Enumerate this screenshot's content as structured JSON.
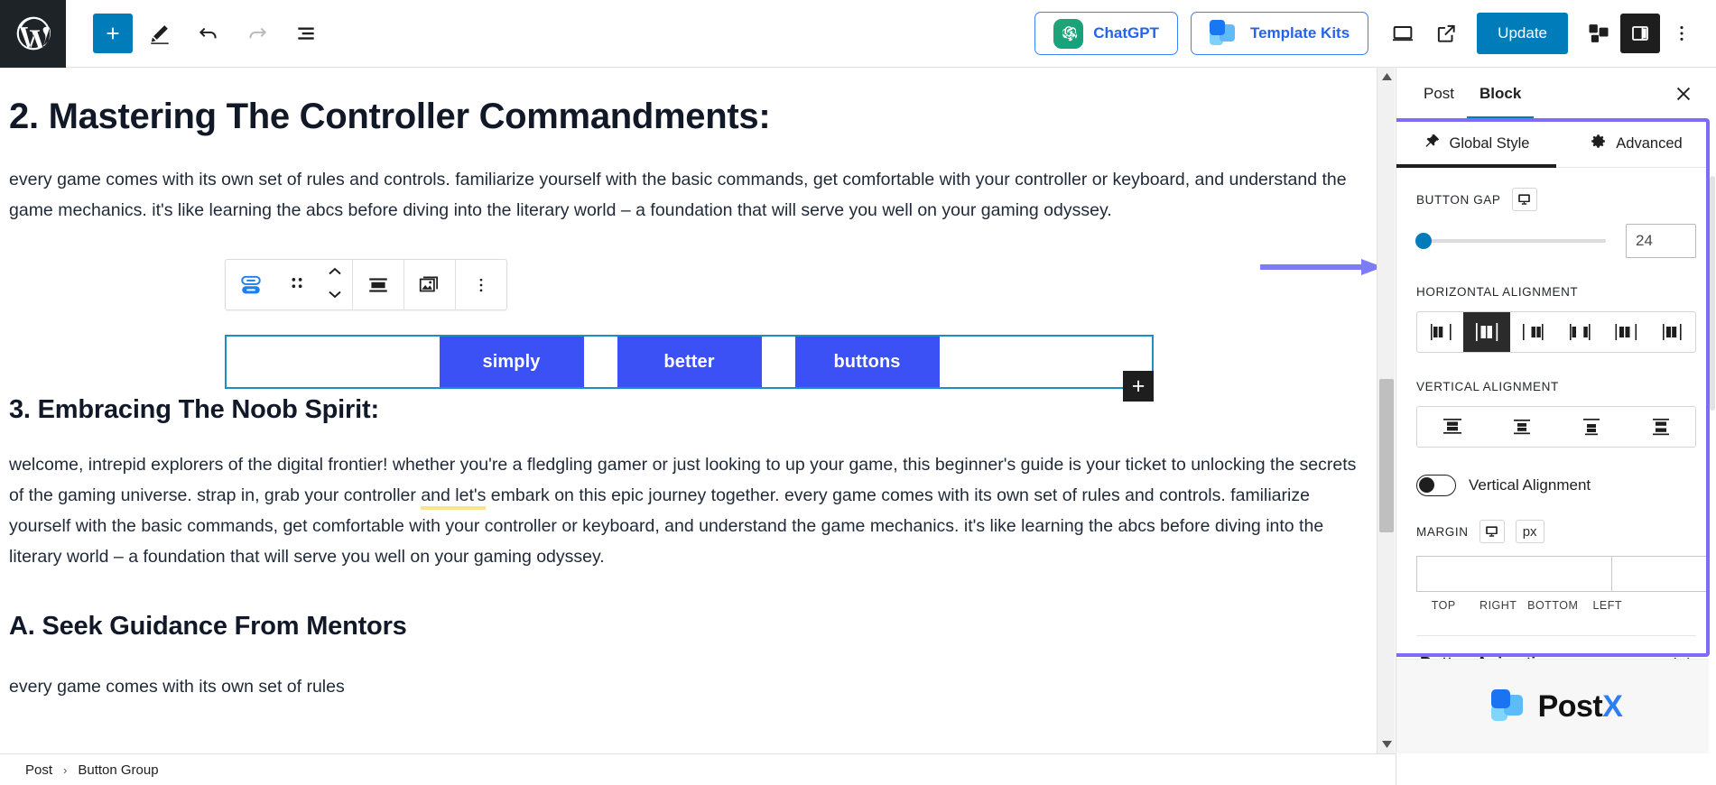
{
  "toolbar": {
    "wordpress_logo": "wordpress-logo",
    "add_block_label": "+",
    "tools_icon": "pencil-icon",
    "undo_icon": "undo-icon",
    "redo_icon": "redo-icon",
    "list_view_icon": "document-outline-icon",
    "chatgpt_label": "ChatGPT",
    "template_kits_label": "Template Kits",
    "preview_icon": "desktop-preview-icon",
    "view_icon": "external-link-icon",
    "update_label": "Update",
    "blocks_icon": "blocks-grid-icon",
    "settings_icon": "sidebar-panel-icon",
    "options_icon": "kebab-menu-icon"
  },
  "content": {
    "heading_1": "2. Mastering The Controller Commandments:",
    "paragraph_1": "every game comes with its own set of rules and controls. familiarize yourself with the basic commands, get comfortable with your controller or keyboard, and understand the game mechanics. it's like learning the abcs before diving into the literary world – a foundation that will serve you well on your gaming odyssey.",
    "heading_2": "3. Embracing The Noob Spirit:",
    "paragraph_2_a": "welcome, intrepid explorers of the digital frontier! whether you're a fledgling gamer or just looking to up your game, this beginner's guide is your ticket to unlocking the secrets of the gaming universe. strap in, grab your controller ",
    "paragraph_2_highlight": "and let's",
    "paragraph_2_b": " embark on this epic journey together. every game comes with its own set of rules and controls. familiarize yourself with the basic commands, get comfortable with your controller or keyboard, and understand the game mechanics. it's like learning the abcs before diving into the literary world – a foundation that will serve you well on your gaming odyssey.",
    "heading_3": "A. Seek Guidance From Mentors",
    "paragraph_3": "every game comes with its own set of rules"
  },
  "block_toolbar": {
    "block_type_icon": "buttons-block-icon",
    "drag_icon": "drag-handle-icon",
    "move_up_icon": "chevron-up-icon",
    "move_down_icon": "chevron-down-icon",
    "align_icon": "align-center-icon",
    "gallery_icon": "image-stack-icon",
    "more_icon": "kebab-menu-icon"
  },
  "button_group": {
    "buttons": [
      "simply",
      "better",
      "buttons"
    ],
    "appender_label": "+",
    "selected_color": "#1a8fc4",
    "button_color": "#3b50f5"
  },
  "sidebar": {
    "tabs": [
      {
        "label": "Post",
        "active": false
      },
      {
        "label": "Block",
        "active": true
      }
    ],
    "close_icon": "close-icon",
    "panel_tabs": [
      {
        "label": "Global Style",
        "icon": "pin-icon",
        "active": true
      },
      {
        "label": "Advanced",
        "icon": "gear-icon",
        "active": false
      }
    ],
    "button_gap": {
      "label": "BUTTON GAP",
      "responsive_icon": "desktop-icon",
      "value": "24",
      "slider_percent": 4
    },
    "horizontal_alignment": {
      "label": "HORIZONTAL ALIGNMENT",
      "options": [
        "flex-start",
        "center",
        "flex-end",
        "space-between",
        "space-around",
        "space-evenly"
      ],
      "selected_index": 1
    },
    "vertical_alignment": {
      "label": "VERTICAL ALIGNMENT",
      "options": [
        "top",
        "middle",
        "bottom",
        "stretch"
      ],
      "selected_index": -1
    },
    "vertical_alignment_toggle": {
      "label": "Vertical Alignment",
      "enabled": false
    },
    "margin": {
      "label": "MARGIN",
      "responsive_icon": "desktop-icon",
      "unit": "px",
      "values": [
        "",
        "",
        "",
        ""
      ],
      "sides": [
        "TOP",
        "RIGHT",
        "BOTTOM",
        "LEFT"
      ],
      "link_icon": "unlink-icon"
    },
    "accordion": {
      "title": "Button Animation",
      "chevron_icon": "chevron-down-icon"
    },
    "brand": {
      "name_dark": "Post",
      "name_accent": "X"
    },
    "highlight_color": "#7c6cf7"
  },
  "breadcrumb": {
    "items": [
      "Post",
      "Button Group"
    ],
    "separator": "›"
  }
}
